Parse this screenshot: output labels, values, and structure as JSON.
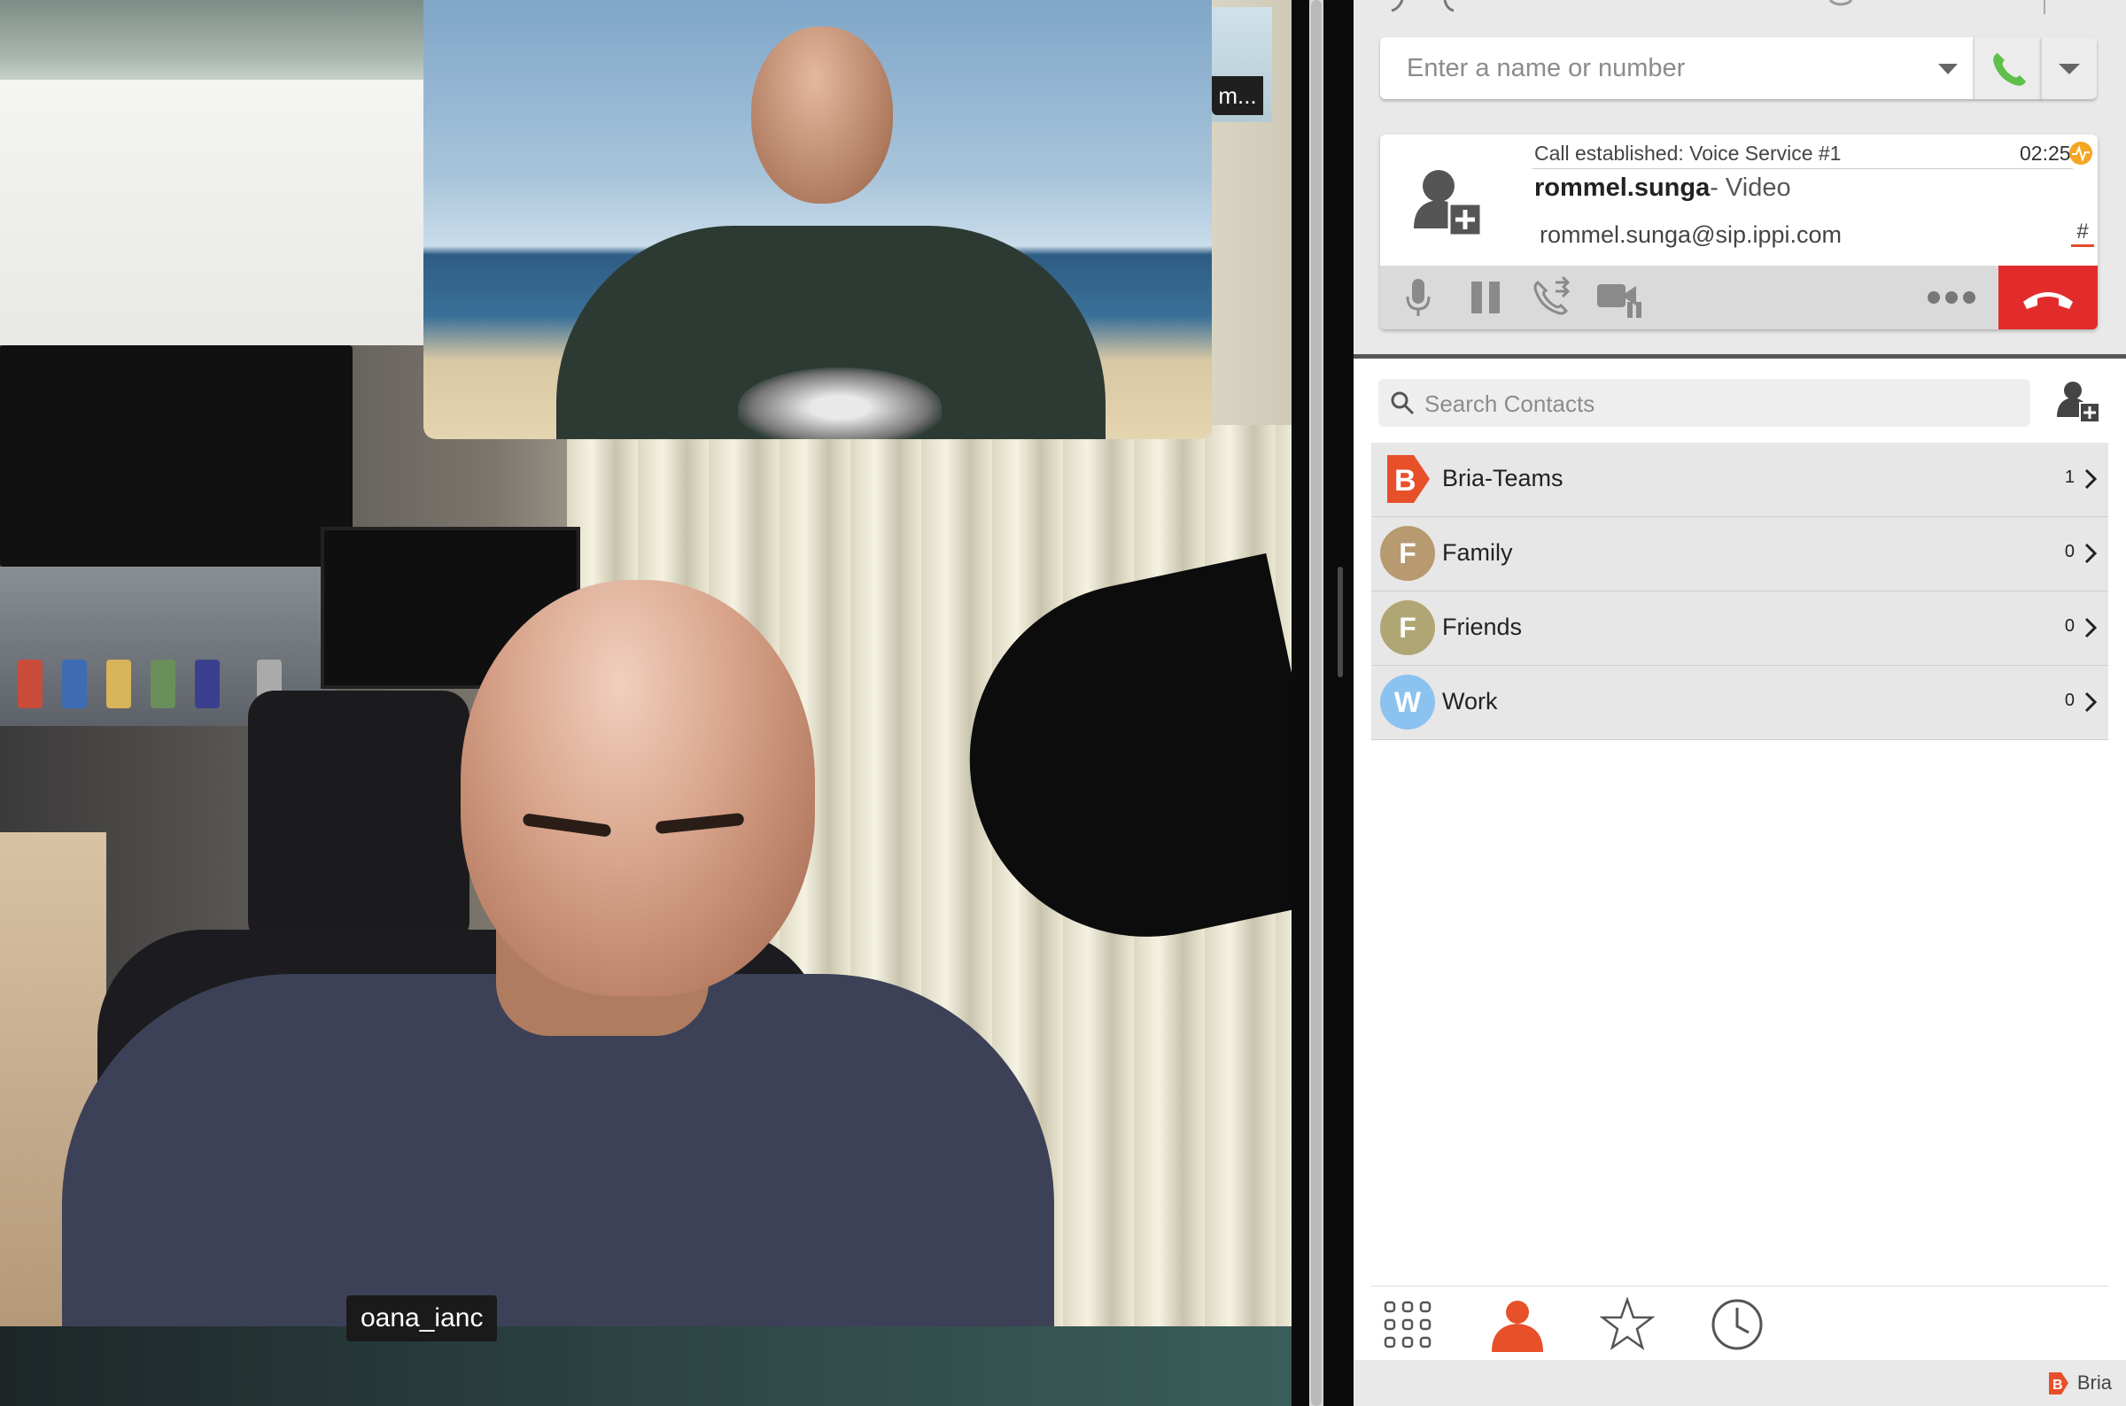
{
  "video": {
    "participant_name": "oana_ianc",
    "pip_label_truncated": "m..."
  },
  "dialer": {
    "placeholder": "Enter a name or number"
  },
  "call": {
    "status": "Call established: Voice Service #1",
    "timer": "02:25",
    "contact_name": "rommel.sunga",
    "call_type": "- Video",
    "sip_address": "rommel.sunga@sip.ippi.com",
    "keypad_symbol": "#"
  },
  "contacts": {
    "search_placeholder": "Search Contacts",
    "groups": [
      {
        "label": "Bria-Teams",
        "avatar": "B",
        "count": "1",
        "color": "#e8502a"
      },
      {
        "label": "Family",
        "avatar": "F",
        "count": "0",
        "color": "#b79a6f"
      },
      {
        "label": "Friends",
        "avatar": "F",
        "count": "0",
        "color": "#b0a673"
      },
      {
        "label": "Work",
        "avatar": "W",
        "count": "0",
        "color": "#8cc2ef"
      }
    ]
  },
  "bottom_nav": {
    "icons": [
      "dialpad-icon",
      "contacts-icon",
      "favorites-icon",
      "history-icon"
    ],
    "active": "contacts-icon"
  },
  "footer": {
    "brand": "Bria"
  },
  "colors": {
    "accent": "#e8502a",
    "hangup": "#e22b2b",
    "call_green": "#5fbf4a"
  }
}
